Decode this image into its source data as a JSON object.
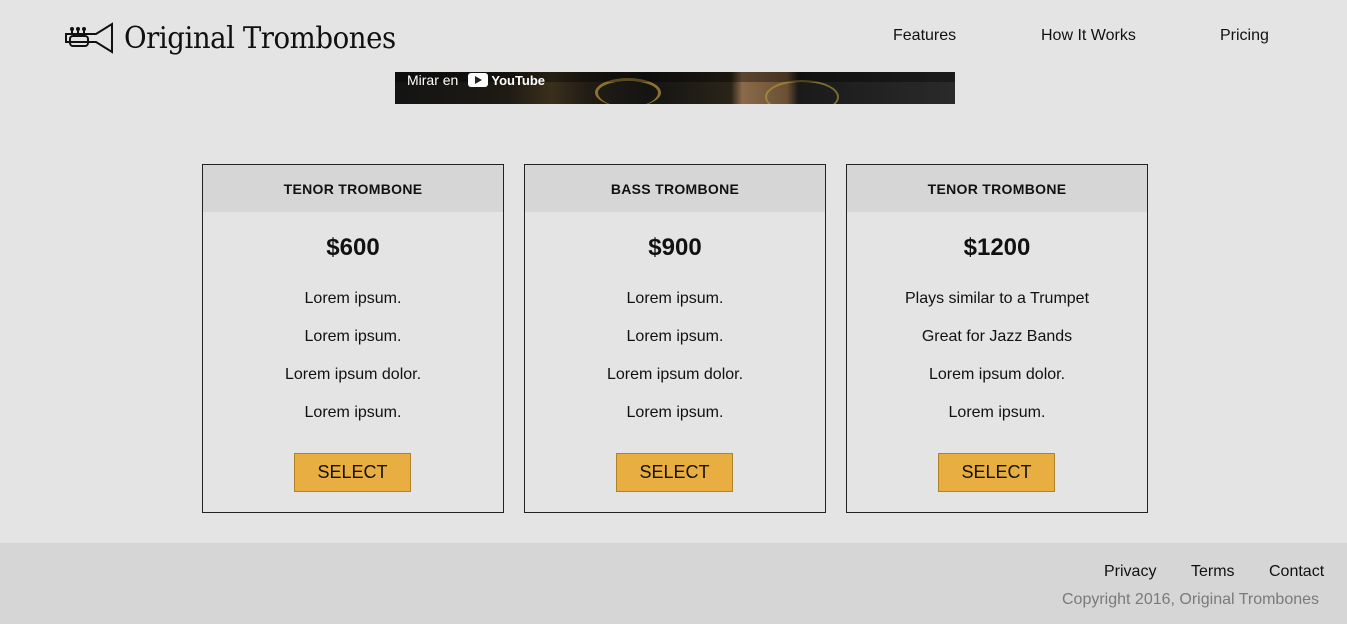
{
  "header": {
    "brand": "Original Trombones",
    "logo_icon": "trumpet-icon",
    "nav": [
      "Features",
      "How It Works",
      "Pricing"
    ]
  },
  "video": {
    "watch_label": "Mirar en",
    "platform": "YouTube",
    "platform_icon": "youtube-play-icon"
  },
  "pricing": {
    "cards": [
      {
        "title": "TENOR TROMBONE",
        "price": "$600",
        "features": [
          "Lorem ipsum.",
          "Lorem ipsum.",
          "Lorem ipsum dolor.",
          "Lorem ipsum."
        ],
        "button": "SELECT"
      },
      {
        "title": "BASS TROMBONE",
        "price": "$900",
        "features": [
          "Lorem ipsum.",
          "Lorem ipsum.",
          "Lorem ipsum dolor.",
          "Lorem ipsum."
        ],
        "button": "SELECT"
      },
      {
        "title": "TENOR TROMBONE",
        "price": "$1200",
        "features": [
          "Plays similar to a Trumpet",
          "Great for Jazz Bands",
          "Lorem ipsum dolor.",
          "Lorem ipsum."
        ],
        "button": "SELECT"
      }
    ]
  },
  "footer": {
    "links": [
      "Privacy",
      "Terms",
      "Contact"
    ],
    "copyright": "Copyright 2016, Original Trombones"
  },
  "colors": {
    "background": "#e5e4e4",
    "card_header": "#d6d6d6",
    "button": "#e8ae42",
    "footer": "#d6d6d6",
    "copyright_text": "#7a7a7a"
  }
}
